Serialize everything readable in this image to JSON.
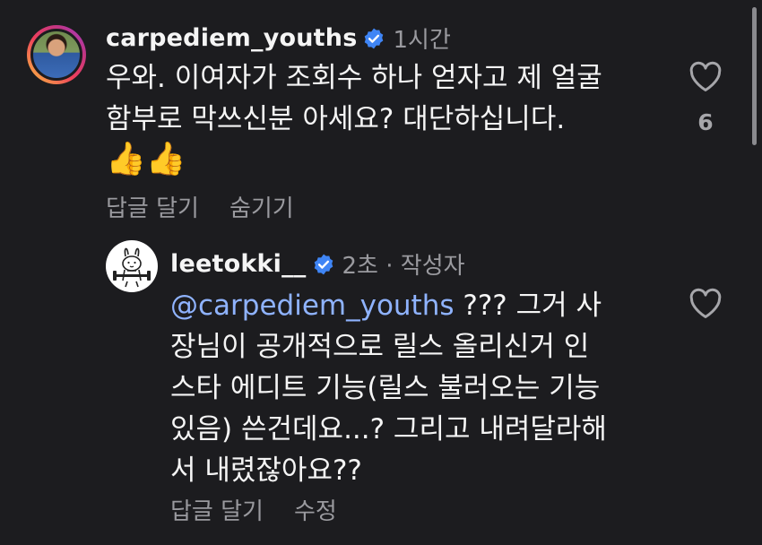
{
  "comments": [
    {
      "username": "carpediem_youths",
      "time": "1시간",
      "verified": true,
      "text_lines": [
        "우와. 이여자가 조회수 하나 얻자고 제 얼굴",
        "함부로 막쓰신분 아세요? 대단하십니다."
      ],
      "emoji": "👍👍",
      "reply_label": "답글 달기",
      "extra_action": "숨기기",
      "like_count": "6"
    },
    {
      "username": "leetokki__",
      "time": "2초 · 작성자",
      "verified": true,
      "mention": "@carpediem_youths",
      "text_first_rest": " ??? 그거 사",
      "text_lines": [
        "장님이 공개적으로 릴스 올리신거 인",
        "스타 에디트 기능(릴스 불러오는 기능",
        "있음) 쓴건데요...? 그리고 내려달라해",
        "서 내렸잖아요??"
      ],
      "reply_label": "답글 달기",
      "extra_action": "수정"
    }
  ],
  "colors": {
    "background": "#1c1c1f",
    "mention": "#8fb3ff",
    "verified": "#3f85f5",
    "muted": "#9a9a9f"
  },
  "icons": [
    "verified-badge-icon",
    "heart-icon"
  ]
}
